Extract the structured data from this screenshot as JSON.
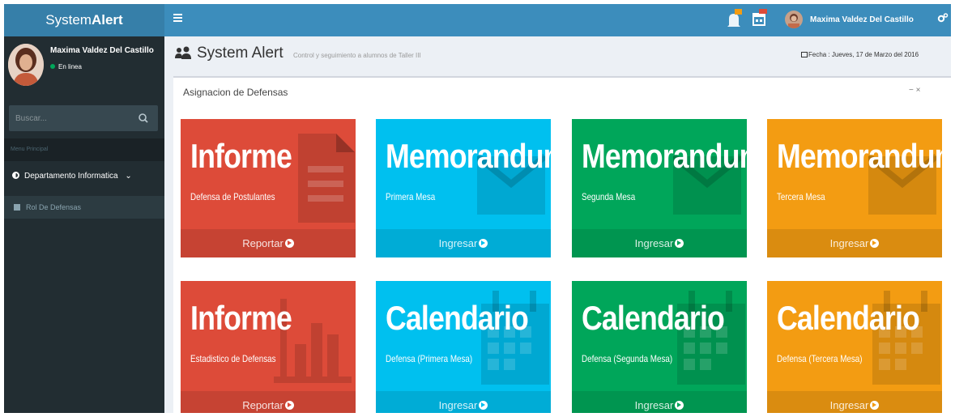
{
  "app": {
    "logo_a": "System",
    "logo_b": "Alert"
  },
  "topbar": {
    "user_name": "Maxima Valdez Del Castillo",
    "icons": [
      "hamburger-icon",
      "bell-icon",
      "calendar-icon",
      "gears-icon"
    ]
  },
  "sidebar": {
    "user_name": "Maxima Valdez Del Castillo",
    "status": "En linea",
    "search_placeholder": "Buscar...",
    "menu_header": "Menu Principal",
    "department": "Departamento Informatica",
    "sub_item": "Rol De Defensas"
  },
  "header": {
    "title": "System Alert",
    "subtitle": "Control y seguimiento a alumnos de Taller III",
    "date": "Fecha : Jueves, 17 de Marzo del 2016"
  },
  "box": {
    "title": "Asignacion de Defensas",
    "tools": "−  ×"
  },
  "tiles": [
    {
      "title": "Informe",
      "subtitle": "Defensa de Postulantes",
      "action": "Reportar",
      "color": "#dd4b39",
      "icon": "document-icon"
    },
    {
      "title": "Memorandum",
      "subtitle": "Primera Mesa",
      "action": "Ingresar",
      "color": "#00c0ef",
      "icon": "envelope-icon"
    },
    {
      "title": "Memorandum",
      "subtitle": "Segunda Mesa",
      "action": "Ingresar",
      "color": "#00a65a",
      "icon": "envelope-icon"
    },
    {
      "title": "Memorandum",
      "subtitle": "Tercera Mesa",
      "action": "Ingresar",
      "color": "#f39c12",
      "icon": "envelope-icon"
    },
    {
      "title": "Informe",
      "subtitle": "Estadistico de Defensas",
      "action": "Reportar",
      "color": "#dd4b39",
      "icon": "bar-chart-icon"
    },
    {
      "title": "Calendario",
      "subtitle": "Defensa (Primera Mesa)",
      "action": "Ingresar",
      "color": "#00c0ef",
      "icon": "calendar-icon"
    },
    {
      "title": "Calendario",
      "subtitle": "Defensa (Segunda Mesa)",
      "action": "Ingresar",
      "color": "#00a65a",
      "icon": "calendar-icon"
    },
    {
      "title": "Calendario",
      "subtitle": "Defensa (Tercera Mesa)",
      "action": "Ingresar",
      "color": "#f39c12",
      "icon": "calendar-icon"
    }
  ]
}
